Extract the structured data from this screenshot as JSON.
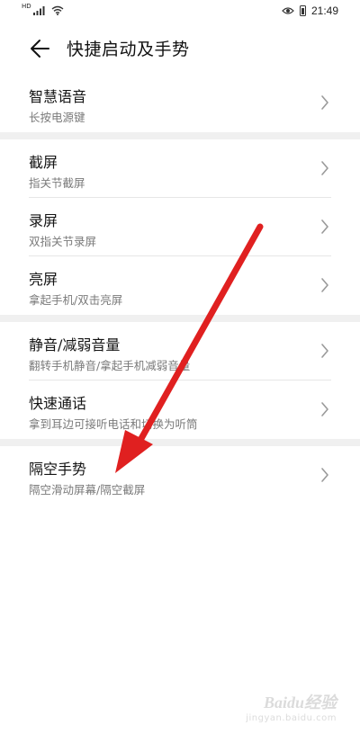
{
  "status_bar": {
    "network_badge": "HD",
    "time": "21:49",
    "icons": [
      "signal-icon",
      "wifi-icon",
      "eye-icon",
      "battery-icon"
    ]
  },
  "header": {
    "title": "快捷启动及手势",
    "back_icon": "back-arrow-icon"
  },
  "groups": [
    {
      "items": [
        {
          "label": "智慧语音",
          "sub": "长按电源键"
        }
      ]
    },
    {
      "items": [
        {
          "label": "截屏",
          "sub": "指关节截屏"
        },
        {
          "label": "录屏",
          "sub": "双指关节录屏"
        },
        {
          "label": "亮屏",
          "sub": "拿起手机/双击亮屏"
        }
      ]
    },
    {
      "items": [
        {
          "label": "静音/减弱音量",
          "sub": "翻转手机静音/拿起手机减弱音量"
        },
        {
          "label": "快速通话",
          "sub": "拿到耳边可接听电话和切换为听筒"
        }
      ]
    },
    {
      "items": [
        {
          "label": "隔空手势",
          "sub": "隔空滑动屏幕/隔空截屏"
        }
      ]
    }
  ],
  "annotation": {
    "color": "#e02020"
  },
  "watermark": {
    "logo": "Baidu经验",
    "url": "jingyan.baidu.com"
  }
}
